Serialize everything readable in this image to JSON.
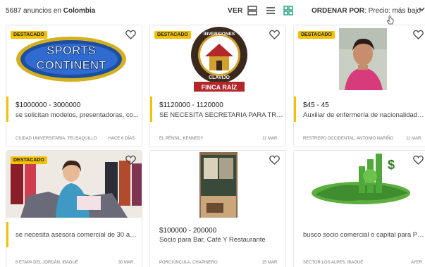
{
  "header": {
    "count_number": "5687",
    "count_text": "anuncios en",
    "location": "Colombia",
    "view_label": "VER",
    "order_label": "ORDENAR POR",
    "order_value": ": Precio: más bajo"
  },
  "colors": {
    "accent": "#f2c200"
  },
  "listings": [
    {
      "badge": "DESTACADO",
      "image_text_1": "SPORTS",
      "image_text_2": "CONTINENT",
      "price": "$1000000 - 3000000",
      "title": "se solicitan modelos, presentadoras, co...",
      "location": "CIUDAD UNIVERSITARIA, TEUSAQUILLO",
      "date": "HACE 6 DÍAS"
    },
    {
      "badge": "DESTACADO",
      "image_text_1": "INVERSIONES",
      "image_text_2": "CLAVIJO",
      "image_text_3": "FINCA RAÍZ",
      "price": "$1120000 - 1120000",
      "title": "SE NECESITA SECRETARIA PARA TRABA...",
      "location": "EL PÉNSIL, KENNEDY",
      "date": "11 MAR."
    },
    {
      "badge": "DESTACADO",
      "price": "$45 - 45",
      "title": "Auxiliar de enfermería de nacionalidad c...",
      "location": "RESTREPO OCCIDENTAL, ANTONIO NARIÑO",
      "date": "11 MAR."
    },
    {
      "badge": "DESTACADO",
      "price": "",
      "title": "se necesita asesora comercial de 30 año...",
      "location": "8 ETAPA DEL JORDÁN, IBAGUÉ",
      "date": "30 MAR."
    },
    {
      "badge": "",
      "price": "$100000 - 200000",
      "title": "Socio para Bar, Café Y Restaurante",
      "location": "PORCIÚNCULA, CHAPINERO",
      "date": "15 MAR."
    },
    {
      "badge": "",
      "price": "",
      "title": "busco socio comercial o capital para PRO...",
      "location": "SECTOR LOS ALPES, IBAGUÉ",
      "date": "AYER"
    }
  ]
}
